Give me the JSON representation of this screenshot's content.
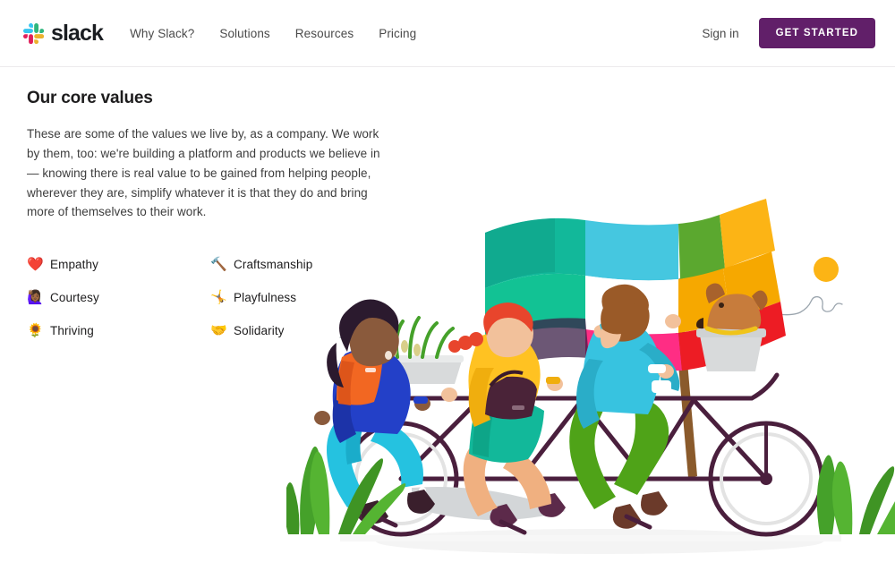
{
  "header": {
    "logo": {
      "icon": "slack-logo-icon",
      "text": "slack"
    },
    "nav_items": [
      {
        "label": "Why Slack?"
      },
      {
        "label": "Solutions"
      },
      {
        "label": "Resources"
      },
      {
        "label": "Pricing"
      }
    ],
    "signin_label": "Sign in",
    "cta_label": "GET STARTED",
    "cta_color": "#611f69"
  },
  "main": {
    "title": "Our core values",
    "intro": "These are some of the values we live by, as a company. We work by them, too: we're building a platform and products we believe in — knowing there is real value to be gained from helping people, wherever they are, simplify whatever it is that they do and bring more of themselves to their work.",
    "values": [
      {
        "emoji": "❤️",
        "icon": "heart-icon",
        "label": "Empathy"
      },
      {
        "emoji": "🙋🏾‍♀️",
        "icon": "person-raising-hand-icon",
        "label": "Courtesy"
      },
      {
        "emoji": "🌻",
        "icon": "sunflower-icon",
        "label": "Thriving"
      },
      {
        "emoji": "🔨",
        "icon": "hammer-icon",
        "label": "Craftsmanship"
      },
      {
        "emoji": "🤸",
        "icon": "person-dancing-icon",
        "label": "Playfulness"
      },
      {
        "emoji": "🤝",
        "icon": "handshake-icon",
        "label": "Solidarity"
      }
    ]
  },
  "illustration": {
    "name": "tandem-bicycle-illustration",
    "description": "Three people riding a tandem bicycle with a colorful flag, a dog in the front basket, plants, grass and a sun",
    "colors": {
      "flag_teal": "#12b89a",
      "flag_green_dark": "#0e9e86",
      "flag_cyan": "#45c7e0",
      "flag_white": "#ffffff",
      "flag_yellow": "#fcb415",
      "flag_orange": "#f6a800",
      "flag_pink": "#ff2d84",
      "flag_red": "#ed1c24",
      "flag_green_olive": "#5ba82f",
      "pole_brown": "#8a5a2b",
      "frame_purple": "#4a1f3d",
      "sun_yellow": "#fcb415",
      "grass_green": "#45a12a",
      "rider1_jacket_blue": "#2340c8",
      "rider1_vest_orange": "#f26722",
      "rider1_pants_cyan": "#25c2e0",
      "rider1_hair": "#2b1a2e",
      "rider2_top_yellow": "#ffc222",
      "rider2_skirt_teal": "#12b89a",
      "rider2_hair_red": "#e8452c",
      "rider2_bag": "#4a2338",
      "rider3_shirt_cyan": "#37c3e0",
      "rider3_pants_green": "#4fa318",
      "rider3_hair_brown": "#9a5a28",
      "dog_brown": "#c77c3c",
      "basket_gray": "#d8d8d8",
      "ground_shadow": "#f2f2f2"
    }
  }
}
